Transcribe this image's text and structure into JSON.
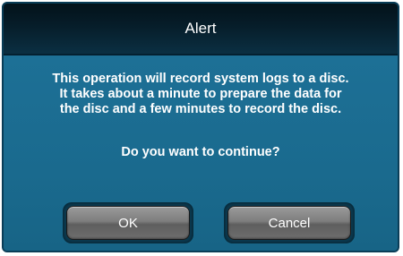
{
  "dialog": {
    "title": "Alert",
    "message_lines": [
      "This operation will record system logs to a disc.",
      "It takes about a minute to prepare the data for",
      "the disc and a few minutes to record the disc."
    ],
    "question": "Do you want to continue?",
    "ok_label": "OK",
    "cancel_label": "Cancel"
  },
  "colors": {
    "titlebar": "#061c28",
    "body": "#1a6a8d",
    "button": "#7e7e7e",
    "text": "#ffffff"
  }
}
